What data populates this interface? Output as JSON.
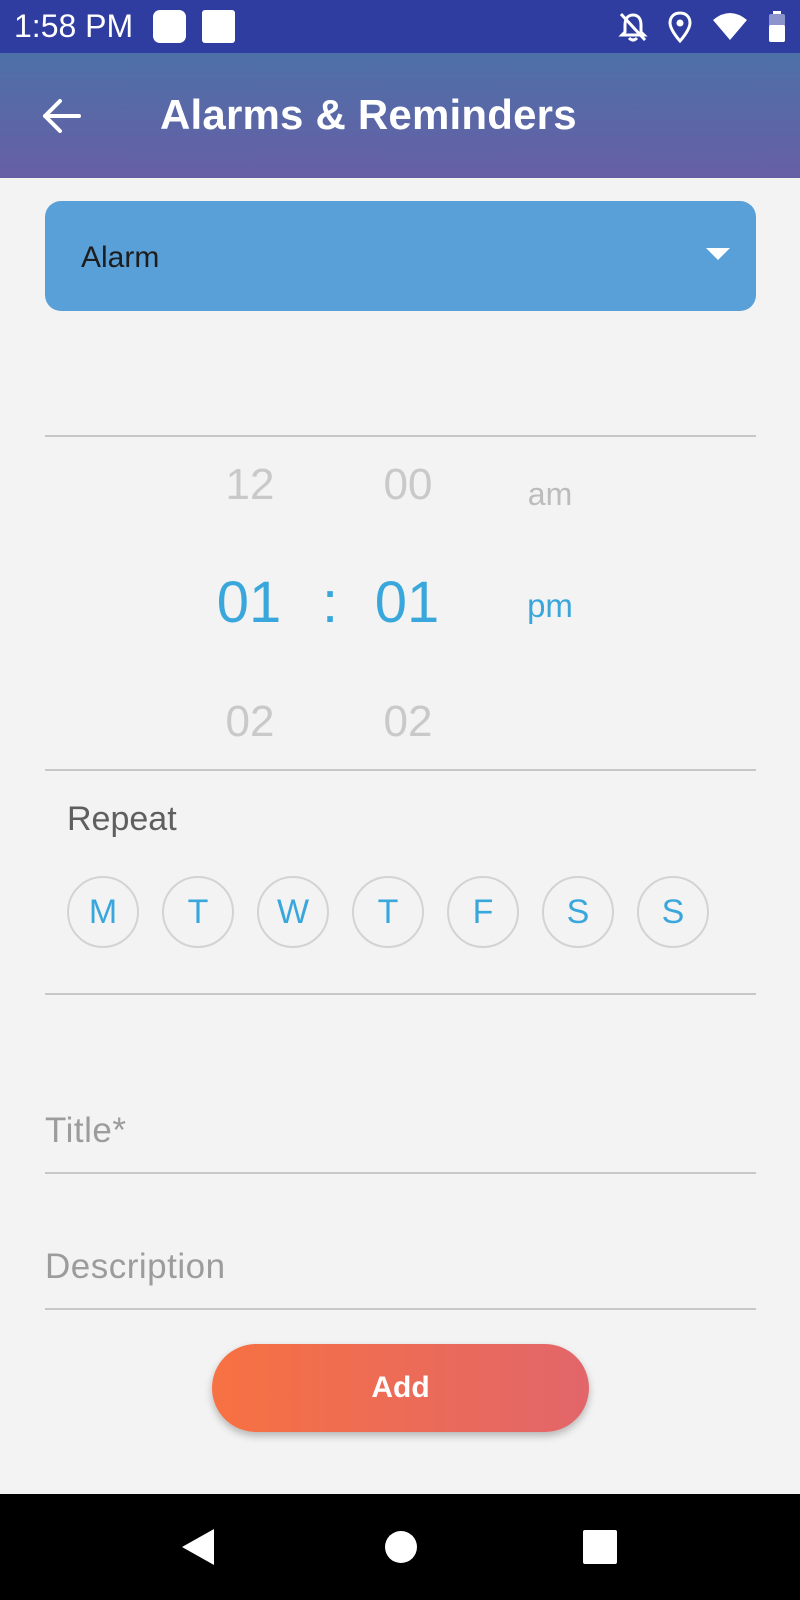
{
  "status_bar": {
    "time": "1:58 PM",
    "icons": [
      "notification-square-icon",
      "notification-square-icon",
      "bell-off-icon",
      "location-pin-icon",
      "wifi-icon",
      "battery-icon"
    ]
  },
  "app_bar": {
    "title": "Alarms & Reminders",
    "back_icon": "back-arrow-icon"
  },
  "type_select": {
    "value": "Alarm"
  },
  "time_picker": {
    "hours": {
      "prev": "12",
      "selected": "01",
      "next": "02"
    },
    "separator": ":",
    "minutes": {
      "prev": "00",
      "selected": "01",
      "next": "02"
    },
    "period": {
      "prev": "am",
      "selected": "pm"
    }
  },
  "repeat": {
    "label": "Repeat",
    "days": [
      "M",
      "T",
      "W",
      "T",
      "F",
      "S",
      "S"
    ]
  },
  "form": {
    "title_placeholder": "Title*",
    "description_placeholder": "Description"
  },
  "actions": {
    "add_label": "Add"
  },
  "colors": {
    "status_bar": "#2f3da0",
    "app_bar_top": "#4d70a8",
    "app_bar_bottom": "#675fa6",
    "dropdown": "#5aa0d8",
    "accent": "#3aa7dc",
    "add_button_start": "#f77142",
    "add_button_end": "#e2666a"
  }
}
